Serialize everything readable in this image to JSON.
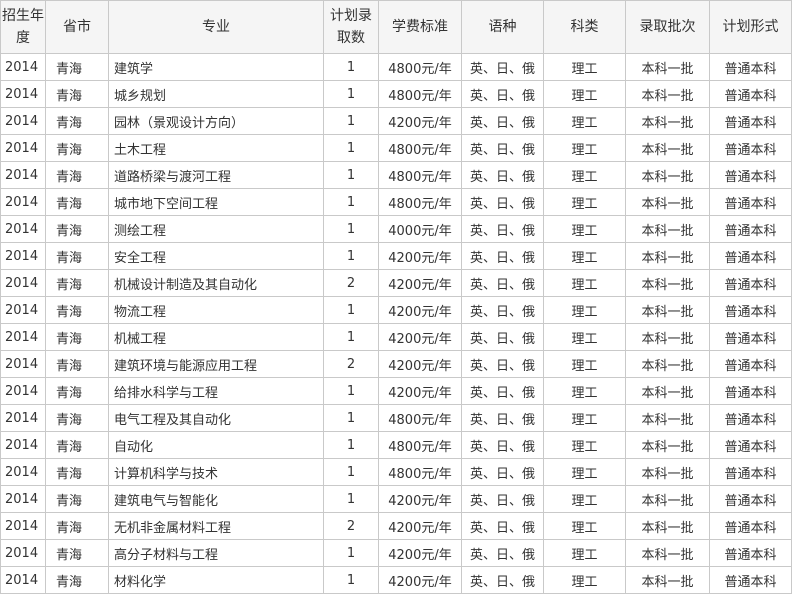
{
  "table": {
    "headers": {
      "year": "招生年度",
      "province": "省市",
      "major": "专业",
      "quota": "计划录取数",
      "fee": "学费标准",
      "language": "语种",
      "category": "科类",
      "batch": "录取批次",
      "form": "计划形式"
    },
    "rows": [
      {
        "year": "2014",
        "province": "青海",
        "major": "建筑学",
        "quota": "1",
        "fee": "4800元/年",
        "language": "英、日、俄",
        "category": "理工",
        "batch": "本科一批",
        "form": "普通本科"
      },
      {
        "year": "2014",
        "province": "青海",
        "major": "城乡规划",
        "quota": "1",
        "fee": "4800元/年",
        "language": "英、日、俄",
        "category": "理工",
        "batch": "本科一批",
        "form": "普通本科"
      },
      {
        "year": "2014",
        "province": "青海",
        "major": "园林（景观设计方向）",
        "quota": "1",
        "fee": "4200元/年",
        "language": "英、日、俄",
        "category": "理工",
        "batch": "本科一批",
        "form": "普通本科"
      },
      {
        "year": "2014",
        "province": "青海",
        "major": "土木工程",
        "quota": "1",
        "fee": "4800元/年",
        "language": "英、日、俄",
        "category": "理工",
        "batch": "本科一批",
        "form": "普通本科"
      },
      {
        "year": "2014",
        "province": "青海",
        "major": "道路桥梁与渡河工程",
        "quota": "1",
        "fee": "4800元/年",
        "language": "英、日、俄",
        "category": "理工",
        "batch": "本科一批",
        "form": "普通本科"
      },
      {
        "year": "2014",
        "province": "青海",
        "major": "城市地下空间工程",
        "quota": "1",
        "fee": "4800元/年",
        "language": "英、日、俄",
        "category": "理工",
        "batch": "本科一批",
        "form": "普通本科"
      },
      {
        "year": "2014",
        "province": "青海",
        "major": "测绘工程",
        "quota": "1",
        "fee": "4000元/年",
        "language": "英、日、俄",
        "category": "理工",
        "batch": "本科一批",
        "form": "普通本科"
      },
      {
        "year": "2014",
        "province": "青海",
        "major": "安全工程",
        "quota": "1",
        "fee": "4200元/年",
        "language": "英、日、俄",
        "category": "理工",
        "batch": "本科一批",
        "form": "普通本科"
      },
      {
        "year": "2014",
        "province": "青海",
        "major": "机械设计制造及其自动化",
        "quota": "2",
        "fee": "4200元/年",
        "language": "英、日、俄",
        "category": "理工",
        "batch": "本科一批",
        "form": "普通本科"
      },
      {
        "year": "2014",
        "province": "青海",
        "major": "物流工程",
        "quota": "1",
        "fee": "4200元/年",
        "language": "英、日、俄",
        "category": "理工",
        "batch": "本科一批",
        "form": "普通本科"
      },
      {
        "year": "2014",
        "province": "青海",
        "major": "机械工程",
        "quota": "1",
        "fee": "4200元/年",
        "language": "英、日、俄",
        "category": "理工",
        "batch": "本科一批",
        "form": "普通本科"
      },
      {
        "year": "2014",
        "province": "青海",
        "major": "建筑环境与能源应用工程",
        "quota": "2",
        "fee": "4200元/年",
        "language": "英、日、俄",
        "category": "理工",
        "batch": "本科一批",
        "form": "普通本科"
      },
      {
        "year": "2014",
        "province": "青海",
        "major": "给排水科学与工程",
        "quota": "1",
        "fee": "4200元/年",
        "language": "英、日、俄",
        "category": "理工",
        "batch": "本科一批",
        "form": "普通本科"
      },
      {
        "year": "2014",
        "province": "青海",
        "major": "电气工程及其自动化",
        "quota": "1",
        "fee": "4800元/年",
        "language": "英、日、俄",
        "category": "理工",
        "batch": "本科一批",
        "form": "普通本科"
      },
      {
        "year": "2014",
        "province": "青海",
        "major": "自动化",
        "quota": "1",
        "fee": "4800元/年",
        "language": "英、日、俄",
        "category": "理工",
        "batch": "本科一批",
        "form": "普通本科"
      },
      {
        "year": "2014",
        "province": "青海",
        "major": "计算机科学与技术",
        "quota": "1",
        "fee": "4800元/年",
        "language": "英、日、俄",
        "category": "理工",
        "batch": "本科一批",
        "form": "普通本科"
      },
      {
        "year": "2014",
        "province": "青海",
        "major": "建筑电气与智能化",
        "quota": "1",
        "fee": "4200元/年",
        "language": "英、日、俄",
        "category": "理工",
        "batch": "本科一批",
        "form": "普通本科"
      },
      {
        "year": "2014",
        "province": "青海",
        "major": "无机非金属材料工程",
        "quota": "2",
        "fee": "4200元/年",
        "language": "英、日、俄",
        "category": "理工",
        "batch": "本科一批",
        "form": "普通本科"
      },
      {
        "year": "2014",
        "province": "青海",
        "major": "高分子材料与工程",
        "quota": "1",
        "fee": "4200元/年",
        "language": "英、日、俄",
        "category": "理工",
        "batch": "本科一批",
        "form": "普通本科"
      },
      {
        "year": "2014",
        "province": "青海",
        "major": "材料化学",
        "quota": "1",
        "fee": "4200元/年",
        "language": "英、日、俄",
        "category": "理工",
        "batch": "本科一批",
        "form": "普通本科"
      }
    ]
  }
}
